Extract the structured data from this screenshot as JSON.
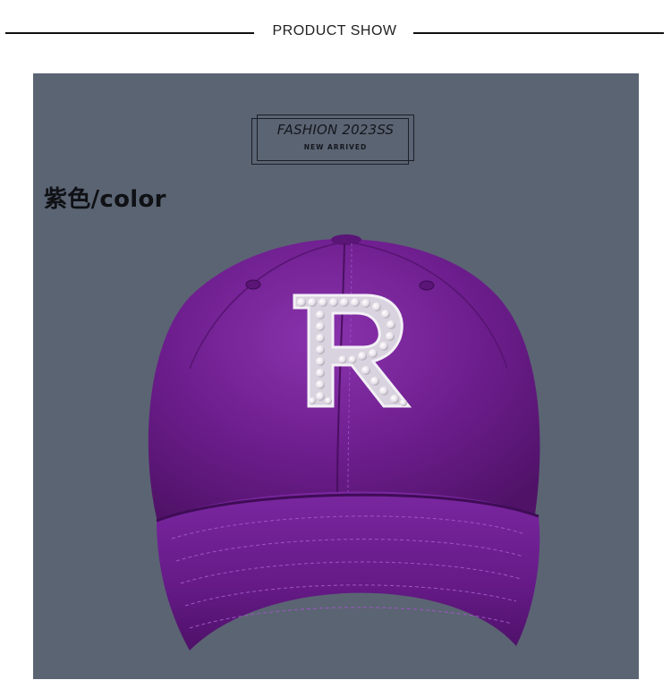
{
  "header": {
    "title": "PRODUCT SHOW"
  },
  "photo": {
    "badge_title": "FASHION 2023SS",
    "badge_subtitle": "NEW ARRIVED",
    "color_label": "紫色/color",
    "emblem_letter": "R",
    "colors": {
      "background": "#5b6473",
      "cap": "#6c1d8c",
      "cap_dark": "#4f1267",
      "cap_light": "#8a33ad",
      "emblem": "#e9e6ee"
    }
  }
}
